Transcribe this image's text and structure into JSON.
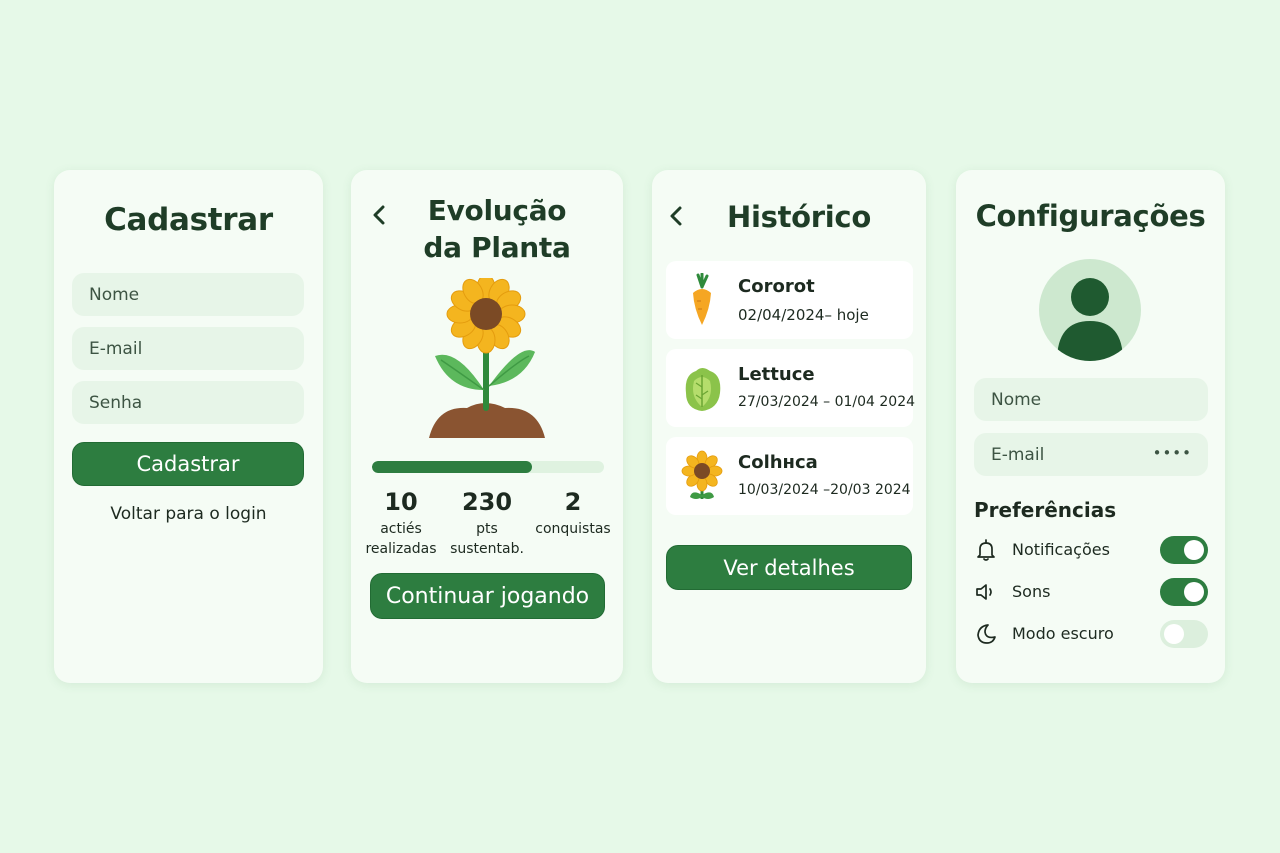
{
  "signup": {
    "title": "Cadastrar",
    "name_placeholder": "Nome",
    "email_placeholder": "E-mail",
    "password_placeholder": "Senha",
    "submit_label": "Cadastrar",
    "back_link": "Voltar para o login"
  },
  "evolution": {
    "title_line1": "Evolução",
    "title_line2": "da Planta",
    "progress_fraction": 0.69,
    "stats": [
      {
        "value": "10",
        "label1": "actiés",
        "label2": "realizadas"
      },
      {
        "value": "230",
        "label1": "pts",
        "label2": "sustentab."
      },
      {
        "value": "2",
        "label1": "conquistas",
        "label2": ""
      }
    ],
    "continue_label": "Continuar jogando"
  },
  "history": {
    "title": "Histórico",
    "items": [
      {
        "name": "Cororot",
        "dates": "02/04/2024– hoje",
        "icon": "carrot-icon"
      },
      {
        "name": "Lettuce",
        "dates": "27/03/2024 – 01/04 2024",
        "icon": "lettuce-icon"
      },
      {
        "name": "Colhнca",
        "dates": "10/03/2024 –20/03 2024",
        "icon": "sunflower-icon"
      }
    ],
    "details_label": "Ver detalhes"
  },
  "settings": {
    "title": "Configurações",
    "name_placeholder": "Nome",
    "email_placeholder": "E-mail",
    "email_masked": "••••",
    "preferences_title": "Preferências",
    "prefs": [
      {
        "label": "Notificações",
        "icon": "bell-icon",
        "on": true
      },
      {
        "label": "Sons",
        "icon": "speaker-icon",
        "on": true
      },
      {
        "label": "Modo escuro",
        "icon": "moon-icon",
        "on": false
      }
    ]
  },
  "colors": {
    "background": "#e6f9e8",
    "card": "#f5fcf5",
    "primary": "#2d7d40",
    "field": "#e7f5e8"
  }
}
